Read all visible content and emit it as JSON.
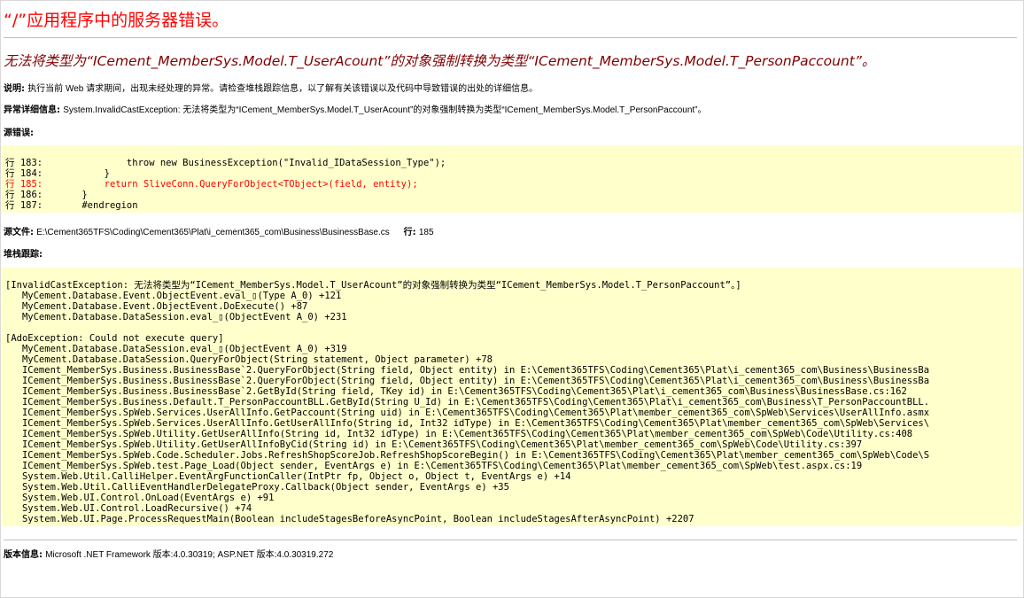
{
  "page": {
    "title": "“/”应用程序中的服务器错误。",
    "subtitle": "无法将类型为“ICement_MemberSys.Model.T_UserAcount”的对象强制转换为类型“ICement_MemberSys.Model.T_PersonPaccount”。"
  },
  "description": {
    "label": "说明:",
    "text": "执行当前 Web 请求期间，出现未经处理的异常。请检查堆栈跟踪信息，以了解有关该错误以及代码中导致错误的出处的详细信息。"
  },
  "exception": {
    "label": "异常详细信息:",
    "text": "System.InvalidCastException: 无法将类型为“ICement_MemberSys.Model.T_UserAcount”的对象强制转换为类型“ICement_MemberSys.Model.T_PersonPaccount”。"
  },
  "source_error": {
    "label": "源错误:",
    "lines": [
      "行 183:               throw new BusinessException(\"Invalid_IDataSession_Type\");",
      "行 184:           }",
      "行 185:           return SliveConn.QueryForObject<TObject>(field, entity);",
      "行 186:       }",
      "行 187:       #endregion"
    ],
    "highlight_index": 2
  },
  "source_file": {
    "label": "源文件:",
    "path": "E:\\Cement365TFS\\Coding\\Cement365\\Plat\\i_cement365_com\\Business\\BusinessBase.cs",
    "line_label": "行:",
    "line": "185"
  },
  "stack_trace": {
    "label": "堆栈跟踪:",
    "lines": [
      "[InvalidCastException: 无法将类型为“ICement_MemberSys.Model.T_UserAcount”的对象强制转换为类型“ICement_MemberSys.Model.T_PersonPaccount”。]",
      "   MyCement.Database.Event.ObjectEvent.eval_▯(Type A_0) +121",
      "   MyCement.Database.Event.ObjectEvent.DoExecute() +87",
      "   MyCement.Database.DataSession.eval_▯(ObjectEvent A_0) +231",
      "",
      "[AdoException: Could not execute query]",
      "   MyCement.Database.DataSession.eval_▯(ObjectEvent A_0) +319",
      "   MyCement.Database.DataSession.QueryForObject(String statement, Object parameter) +78",
      "   ICement_MemberSys.Business.BusinessBase`2.QueryForObject(String field, Object entity) in E:\\Cement365TFS\\Coding\\Cement365\\Plat\\i_cement365_com\\Business\\BusinessBa",
      "   ICement_MemberSys.Business.BusinessBase`2.QueryForObject(String field, Object entity) in E:\\Cement365TFS\\Coding\\Cement365\\Plat\\i_cement365_com\\Business\\BusinessBa",
      "   ICement_MemberSys.Business.BusinessBase`2.GetById(String field, TKey id) in E:\\Cement365TFS\\Coding\\Cement365\\Plat\\i_cement365_com\\Business\\BusinessBase.cs:162",
      "   ICement_MemberSys.Business.Default.T_PersonPaccountBLL.GetById(String U_Id) in E:\\Cement365TFS\\Coding\\Cement365\\Plat\\i_cement365_com\\Business\\T_PersonPaccountBLL.",
      "   ICement_MemberSys.SpWeb.Services.UserAllInfo.GetPaccount(String uid) in E:\\Cement365TFS\\Coding\\Cement365\\Plat\\member_cement365_com\\SpWeb\\Services\\UserAllInfo.asmx",
      "   ICement_MemberSys.SpWeb.Services.UserAllInfo.GetUserAllInfo(String id, Int32 idType) in E:\\Cement365TFS\\Coding\\Cement365\\Plat\\member_cement365_com\\SpWeb\\Services\\",
      "   ICement_MemberSys.SpWeb.Utility.GetUserAllInfo(String id, Int32 idType) in E:\\Cement365TFS\\Coding\\Cement365\\Plat\\member_cement365_com\\SpWeb\\Code\\Utility.cs:408",
      "   ICement_MemberSys.SpWeb.Utility.GetUserAllInfoByCid(String id) in E:\\Cement365TFS\\Coding\\Cement365\\Plat\\member_cement365_com\\SpWeb\\Code\\Utility.cs:397",
      "   ICement_MemberSys.SpWeb.Code.Scheduler.Jobs.RefreshShopScoreJob.RefreshShopScoreBegin() in E:\\Cement365TFS\\Coding\\Cement365\\Plat\\member_cement365_com\\SpWeb\\Code\\S",
      "   ICement_MemberSys.SpWeb.test.Page_Load(Object sender, EventArgs e) in E:\\Cement365TFS\\Coding\\Cement365\\Plat\\member_cement365_com\\SpWeb\\test.aspx.cs:19",
      "   System.Web.Util.CalliHelper.EventArgFunctionCaller(IntPtr fp, Object o, Object t, EventArgs e) +14",
      "   System.Web.Util.CalliEventHandlerDelegateProxy.Callback(Object sender, EventArgs e) +35",
      "   System.Web.UI.Control.OnLoad(EventArgs e) +91",
      "   System.Web.UI.Control.LoadRecursive() +74",
      "   System.Web.UI.Page.ProcessRequestMain(Boolean includeStagesBeforeAsyncPoint, Boolean includeStagesAfterAsyncPoint) +2207"
    ]
  },
  "version": {
    "label": "版本信息:",
    "text": "Microsoft .NET Framework 版本:4.0.30319; ASP.NET 版本:4.0.30319.272"
  },
  "colors": {
    "title": "#ff0000",
    "subtitle": "#800000",
    "code_background": "#ffffcc",
    "highlight_line": "#ff0000"
  }
}
